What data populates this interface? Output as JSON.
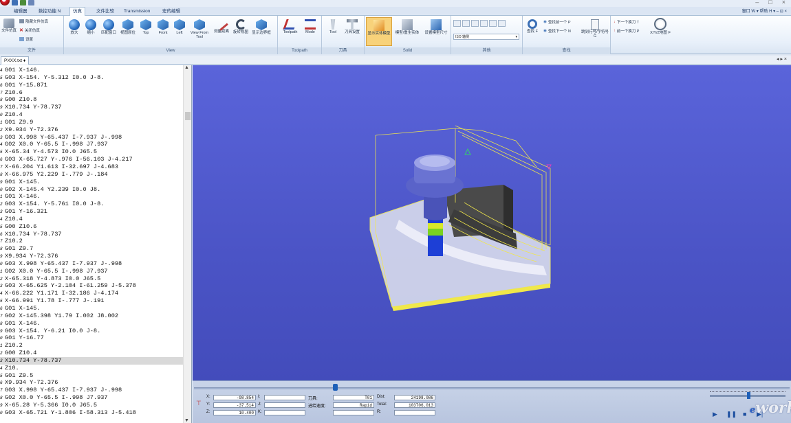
{
  "window": {
    "quick_access": [
      "save-icon",
      "undo-icon",
      "redo-icon"
    ],
    "controls": [
      "–",
      "□",
      "×"
    ]
  },
  "ribbon_tabs": [
    "编辑器",
    "数控功能 N",
    "仿真",
    "文件比较",
    "Transmission",
    "宏的编辑"
  ],
  "active_tab_index": 2,
  "help_strip": "窗口 W ▾  帮助 H ▾  –  ⊡  ×",
  "ribbon": {
    "file_group": {
      "label": "文件",
      "big_button": "文件仿真",
      "items": [
        "隐藏文件仿真",
        "关闭仿真",
        "设置"
      ]
    },
    "view_group": {
      "label": "View",
      "buttons": [
        "放大",
        "缩小",
        "匹配窗口",
        "视图原位",
        "Top",
        "Front",
        "Left",
        "View From Tool",
        "测量距离",
        "旋转视图",
        "显示边界框"
      ]
    },
    "toolpath_group": {
      "label": "Toolpath",
      "buttons": [
        "Toolpath",
        "Mode"
      ]
    },
    "tool_group": {
      "label": "刀具",
      "buttons": [
        "Tool",
        "刀具设置"
      ]
    },
    "solid_group": {
      "label": "Solid",
      "buttons": [
        "显示实体模型",
        "模型/重生实体",
        "设置模型尺寸"
      ]
    },
    "other_group": {
      "label": "其他",
      "dropdown_value": "ISO 轴侧"
    },
    "search_group": {
      "label": "查找",
      "big_button_1": "查找 F",
      "items": [
        "查找前一个 P",
        "查找下一个 N"
      ],
      "big_button_2": "跳到行号/字符号 G"
    },
    "goto_group": {
      "items": [
        "下一个换刀 T",
        "前一个换刀 P"
      ],
      "big_button": "X/Y/Z地图 F"
    }
  },
  "document": {
    "tab_label": "PXXX.txt",
    "pin": "♦",
    "tab_controls": "◂ ▸ ×"
  },
  "code_lines": [
    {
      "ln": "4",
      "text": "G01 X-146."
    },
    {
      "ln": "5",
      "text": "G03 X-154. Y-5.312 I0.0 J-8."
    },
    {
      "ln": "6",
      "text": "G01 Y-15.871"
    },
    {
      "ln": "7",
      "text": "Z10.6"
    },
    {
      "ln": "8",
      "text": "G00 Z10.8"
    },
    {
      "ln": "9",
      "text": "X10.734 Y-78.737"
    },
    {
      "ln": "0",
      "text": "Z10.4"
    },
    {
      "ln": "1",
      "text": "G01 Z9.9"
    },
    {
      "ln": "2",
      "text": "X9.934 Y-72.376"
    },
    {
      "ln": "3",
      "text": "G03 X.998 Y-65.437 I-7.937 J-.998"
    },
    {
      "ln": "4",
      "text": "G02 X0.0 Y-65.5 I-.998 J7.937"
    },
    {
      "ln": "5",
      "text": "X-65.34 Y-4.573 I0.0 J65.5"
    },
    {
      "ln": "6",
      "text": "G03 X-65.727 Y-.976 I-56.103 J-4.217"
    },
    {
      "ln": "7",
      "text": "X-66.204 Y1.613 I-32.697 J-4.683"
    },
    {
      "ln": "8",
      "text": "X-66.975 Y2.229 I-.779 J-.184"
    },
    {
      "ln": "9",
      "text": "G01 X-145."
    },
    {
      "ln": "0",
      "text": "G02 X-145.4 Y2.239 I0.0 J8."
    },
    {
      "ln": "1",
      "text": "G01 X-146."
    },
    {
      "ln": "2",
      "text": "G03 X-154. Y-5.761 I0.0 J-8."
    },
    {
      "ln": "3",
      "text": "G01 Y-16.321"
    },
    {
      "ln": "4",
      "text": "Z10.4"
    },
    {
      "ln": "5",
      "text": "G00 Z10.6"
    },
    {
      "ln": "6",
      "text": "X10.734 Y-78.737"
    },
    {
      "ln": "7",
      "text": "Z10.2"
    },
    {
      "ln": "8",
      "text": "G01 Z9.7"
    },
    {
      "ln": "9",
      "text": "X9.934 Y-72.376"
    },
    {
      "ln": "0",
      "text": "G03 X.998 Y-65.437 I-7.937 J-.998"
    },
    {
      "ln": "1",
      "text": "G02 X0.0 Y-65.5 I-.998 J7.937"
    },
    {
      "ln": "2",
      "text": "X-65.318 Y-4.873 I0.0 J65.5"
    },
    {
      "ln": "3",
      "text": "G03 X-65.625 Y-2.104 I-61.259 J-5.378"
    },
    {
      "ln": "4",
      "text": "X-66.222 Y1.171 I-32.186 J-4.174"
    },
    {
      "ln": "5",
      "text": "X-66.991 Y1.78 I-.777 J-.191"
    },
    {
      "ln": "6",
      "text": "G01 X-145."
    },
    {
      "ln": "7",
      "text": "G02 X-145.398 Y1.79 I.002 J8.002"
    },
    {
      "ln": "8",
      "text": "G01 X-146."
    },
    {
      "ln": "9",
      "text": "G03 X-154. Y-6.21 I0.0 J-8."
    },
    {
      "ln": "0",
      "text": "G01 Y-16.77"
    },
    {
      "ln": "1",
      "text": "Z10.2"
    },
    {
      "ln": "2",
      "text": "G00 Z10.4"
    },
    {
      "ln": "3",
      "text": "X10.734 Y-78.737"
    },
    {
      "ln": "4",
      "text": "Z10."
    },
    {
      "ln": "5",
      "text": "G01 Z9.5"
    },
    {
      "ln": "6",
      "text": "X9.934 Y-72.376"
    },
    {
      "ln": "7",
      "text": "G03 X.998 Y-65.437 I-7.937 J-.998"
    },
    {
      "ln": "8",
      "text": "G02 X0.0 Y-65.5 I-.998 J7.937"
    },
    {
      "ln": "9",
      "text": "X-65.28 Y-5.366 I0.0 J65.5"
    },
    {
      "ln": "0",
      "text": "G03 X-65.721 Y-1.806 I-58.313 J-5.418"
    }
  ],
  "highlighted_line_index": 39,
  "status": {
    "x_label": "X:",
    "x_value": "-98.854",
    "y_label": "Y:",
    "y_value": "-37.514",
    "z_label": "Z:",
    "z_value": "10.400",
    "i_label": "I:",
    "j_label": "J:",
    "k_label": "K:",
    "tool_label": "刀具:",
    "tool_value": "T01",
    "feed_label": "进给速度:",
    "feed_value": "Rapid",
    "dist_label": "Dist:",
    "dist_value": "24198.086",
    "total_label": "Total:",
    "total_value": "103706.013",
    "r_label": "R:"
  },
  "watermark": {
    "prefix": "e",
    "main": "works"
  },
  "colors": {
    "viewport_bg": "#4b54c6",
    "tool_body": "#5a63c9",
    "tool_band_green": "#7ad21f",
    "tool_band_yellow": "#d6e82a",
    "tool_shank": "#1d3fd6",
    "toolpath": "#f2e84a",
    "workpiece_dark": "#4a4a4a",
    "active_ribbon_btn": "#f8d27a"
  }
}
